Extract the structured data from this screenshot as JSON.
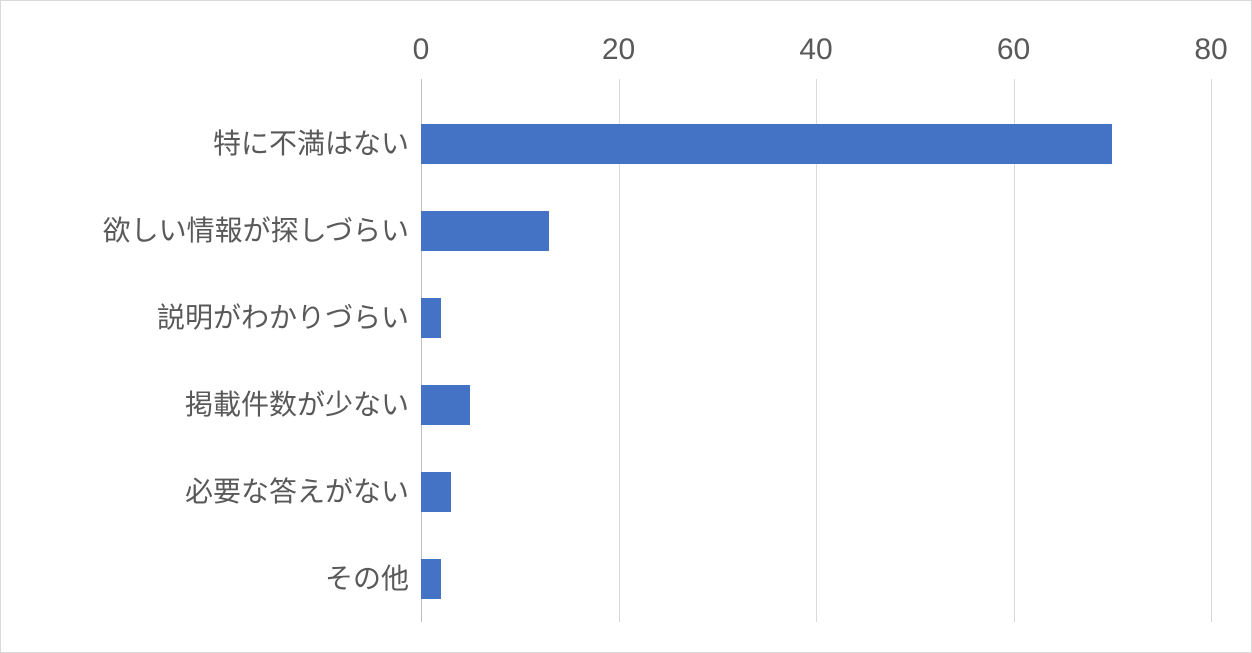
{
  "chart_data": {
    "type": "bar",
    "orientation": "horizontal",
    "categories": [
      "特に不満はない",
      "欲しい情報が探しづらい",
      "説明がわかりづらい",
      "掲載件数が少ない",
      "必要な答えがない",
      "その他"
    ],
    "values": [
      70,
      13,
      2,
      5,
      3,
      2
    ],
    "xlim": [
      0,
      80
    ],
    "xticks": [
      0,
      20,
      40,
      60,
      80
    ],
    "bar_color": "#4472c4",
    "grid_color": "#d9d9d9",
    "axis_position": "top",
    "title": "",
    "xlabel": "",
    "ylabel": ""
  }
}
